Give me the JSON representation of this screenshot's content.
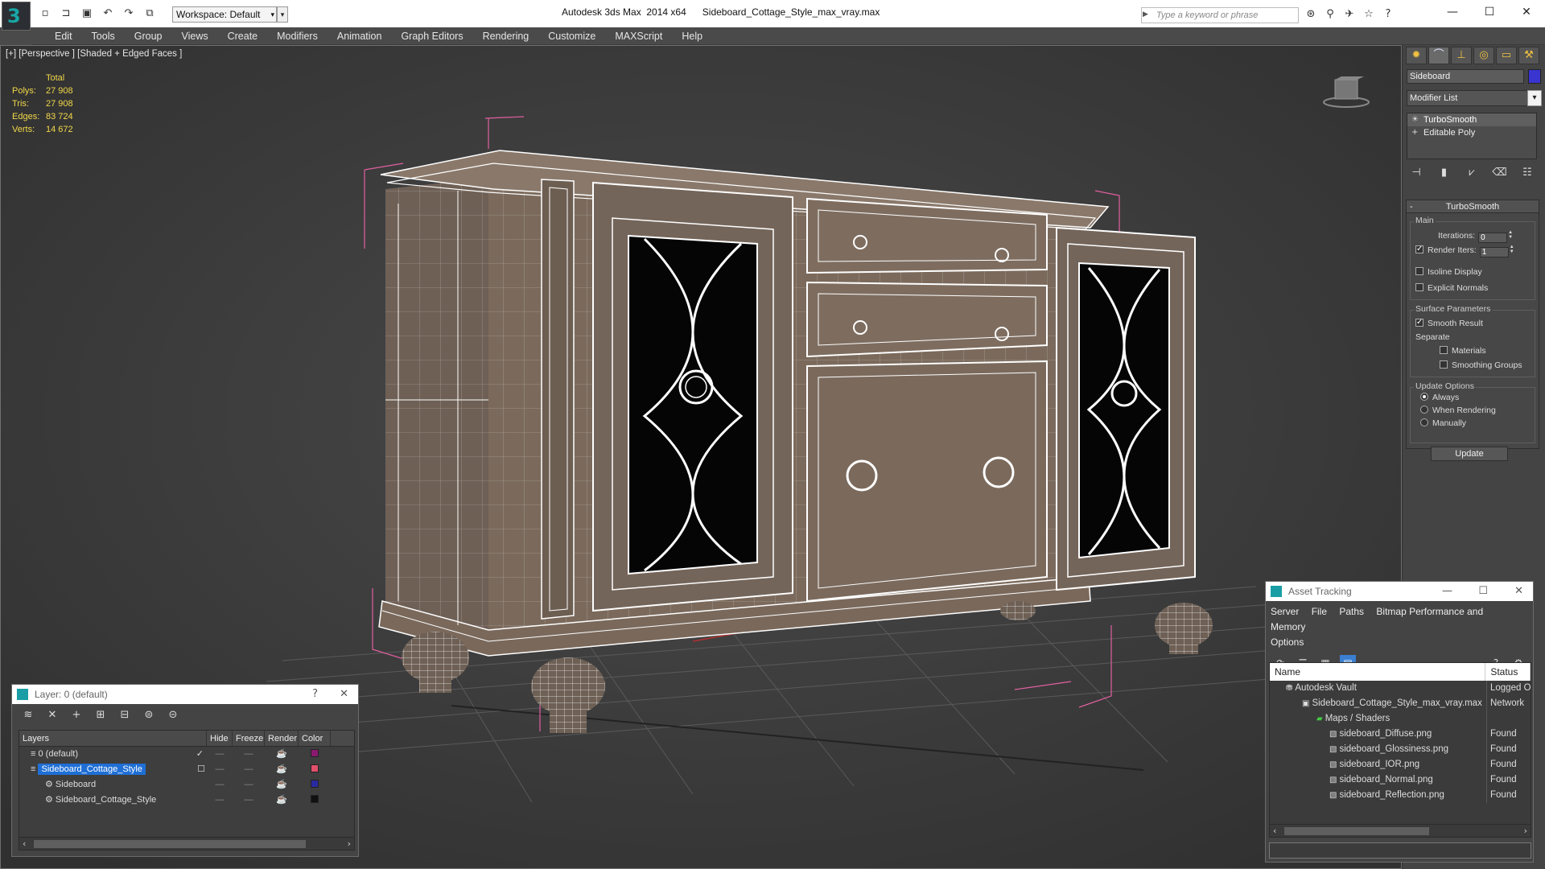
{
  "titlebar": {
    "app_title": "Autodesk 3ds Max  2014 x64      Sideboard_Cottage_Style_max_vray.max",
    "workspace_label": "Workspace: Default",
    "search_placeholder": "Type a keyword or phrase",
    "logo_glyph": "3"
  },
  "menubar": {
    "items": [
      "Edit",
      "Tools",
      "Group",
      "Views",
      "Create",
      "Modifiers",
      "Animation",
      "Graph Editors",
      "Rendering",
      "Customize",
      "MAXScript",
      "Help"
    ]
  },
  "viewport": {
    "label": "[+] [Perspective ] [Shaded + Edged Faces ]",
    "stats": {
      "header": "Total",
      "polys_label": "Polys:",
      "polys": "27 908",
      "tris_label": "Tris:",
      "tris": "27 908",
      "edges_label": "Edges:",
      "edges": "83 724",
      "verts_label": "Verts:",
      "verts": "14 672"
    },
    "colors": {
      "stats_text": "#f2d84a",
      "bbox": "#e060a0",
      "wire": "#ffffff",
      "wood": "#7b6a5c"
    }
  },
  "command_panel": {
    "object_name": "Sideboard",
    "object_color": "#3a34d0",
    "modifier_list_label": "Modifier List",
    "stack": [
      "TurboSmooth",
      "Editable Poly"
    ],
    "rollout_title": "TurboSmooth",
    "main_group": "Main",
    "iterations_label": "Iterations:",
    "iterations_value": "0",
    "render_iters_label": "Render Iters:",
    "render_iters_value": "1",
    "render_iters_checked": true,
    "isoline_label": "Isoline Display",
    "explicit_normals_label": "Explicit Normals",
    "surface_group": "Surface Parameters",
    "smooth_result_label": "Smooth Result",
    "separate_label": "Separate",
    "materials_label": "Materials",
    "smoothing_groups_label": "Smoothing Groups",
    "update_group": "Update Options",
    "always_label": "Always",
    "when_rendering_label": "When Rendering",
    "manually_label": "Manually",
    "update_button": "Update"
  },
  "layer_window": {
    "title": "Layer: 0 (default)",
    "help": "?",
    "close": "✕",
    "columns": [
      "Layers",
      "Hide",
      "Freeze",
      "Render",
      "Color"
    ],
    "rows": [
      {
        "name": "0 (default)",
        "indent": 0,
        "active": true,
        "selected": false,
        "color": "#8a1a70"
      },
      {
        "name": "Sideboard_Cottage_Style",
        "indent": 0,
        "active": false,
        "selected": true,
        "color": "#e0506a"
      },
      {
        "name": "Sideboard",
        "indent": 1,
        "active": false,
        "selected": false,
        "color": "#2a2aa0"
      },
      {
        "name": "Sideboard_Cottage_Style",
        "indent": 1,
        "active": false,
        "selected": false,
        "color": "#111111"
      }
    ]
  },
  "asset_window": {
    "title": "Asset Tracking",
    "menu": [
      "Server",
      "File",
      "Paths",
      "Bitmap Performance and Memory",
      "Options"
    ],
    "columns": [
      "Name",
      "Status"
    ],
    "rows": [
      {
        "name": "Autodesk Vault",
        "status": "Logged O",
        "indent": 1
      },
      {
        "name": "Sideboard_Cottage_Style_max_vray.max",
        "status": "Network",
        "indent": 2
      },
      {
        "name": "Maps / Shaders",
        "status": "",
        "indent": 3
      },
      {
        "name": "sideboard_Diffuse.png",
        "status": "Found",
        "indent": 4
      },
      {
        "name": "sideboard_Glossiness.png",
        "status": "Found",
        "indent": 4
      },
      {
        "name": "sideboard_IOR.png",
        "status": "Found",
        "indent": 4
      },
      {
        "name": "sideboard_Normal.png",
        "status": "Found",
        "indent": 4
      },
      {
        "name": "sideboard_Reflection.png",
        "status": "Found",
        "indent": 4
      }
    ]
  }
}
